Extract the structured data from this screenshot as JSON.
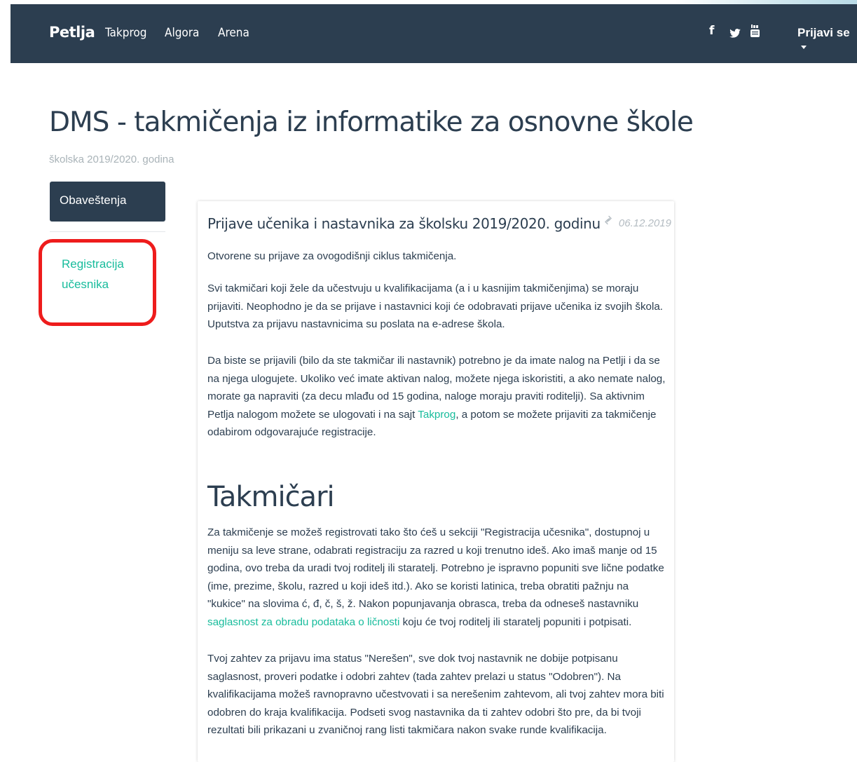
{
  "nav": {
    "brand": "Petlja",
    "links": [
      "Takprog",
      "Algora",
      "Arena"
    ],
    "social": {
      "facebook": "f",
      "twitter": "twitter-icon",
      "youtube": "youtube-icon"
    },
    "login": "Prijavi se"
  },
  "page": {
    "title": "DMS - takmičenja iz informatike za osnovne škole",
    "subtitle": "školska 2019/2020. godina"
  },
  "sidebar": {
    "active": "Obaveštenja",
    "link": "Registracija učesnika"
  },
  "post": {
    "title": "Prijave učenika i nastavnika za školsku 2019/2020. godinu",
    "date": "06.12.2019",
    "p1": "Otvorene su prijave za ovogodišnji ciklus takmičenja.",
    "p2": "Svi takmičari koji žele da učestvuju u kvalifikacijama (a i u kasnijim takmičenjima) se moraju prijaviti. Neophodno je da se prijave i nastavnici koji će odobravati prijave učenika iz svojih škola. Uputstva za prijavu nastavnicima su poslata na e-adrese škola.",
    "p3_before": "Da biste se prijavili (bilo da ste takmičar ili nastavnik) potrebno je da imate nalog na Petlji i da se na njega ulogujete. Ukoliko već imate aktivan nalog, možete njega iskoristiti, a ako nemate nalog, morate ga napraviti (za decu mlađu od 15 godina, naloge moraju praviti roditelji). Sa aktivnim Petlja nalogom možete se ulogovati i na sajt ",
    "p3_link": "Takprog",
    "p3_after": ", a potom se možete prijaviti za takmičenje odabirom odgovarajuće registracije.",
    "heading": "Takmičari",
    "p4_before": "Za takmičenje se možeš registrovati tako što ćeš u sekciji \"Registracija učesnika\", dostupnoj u meniju sa leve strane, odabrati registraciju za razred u koji trenutno ideš. Ako imaš manje od 15 godina, ovo treba da uradi tvoj roditelj ili staratelj. Potrebno je ispravno popuniti sve lične podatke (ime, prezime, školu, razred u koji ideš itd.). Ako se koristi latinica, treba obratiti pažnju na \"kukice\" na slovima ć, đ, č, š, ž. Nakon popunjavanja obrasca, treba da odneseš nastavniku ",
    "p4_link": "saglasnost za obradu podataka o ličnosti",
    "p4_after": " koju će tvoj roditelj ili staratelj popuniti i potpisati.",
    "p5": "Tvoj zahtev za prijavu ima status \"Nerešen\", sve dok tvoj nastavnik ne dobije potpisanu saglasnost, proveri podatke i odobri zahtev (tada zahtev prelazi u status \"Odobren\"). Na kvalifikacijama možeš ravnopravno učestvovati i sa nerešenim zahtevom, ali tvoj zahtev mora biti odobren do kraja kvalifikacija. Podseti svog nastavnika da ti zahtev odobri što pre, da bi tvoji rezultati bili prikazani u zvaničnoj rang listi takmičara nakon svake runde kvalifikacija."
  },
  "colors": {
    "navbar": "#2c3e50",
    "accent": "#18bc9c",
    "annotation": "#ee1c1c"
  }
}
